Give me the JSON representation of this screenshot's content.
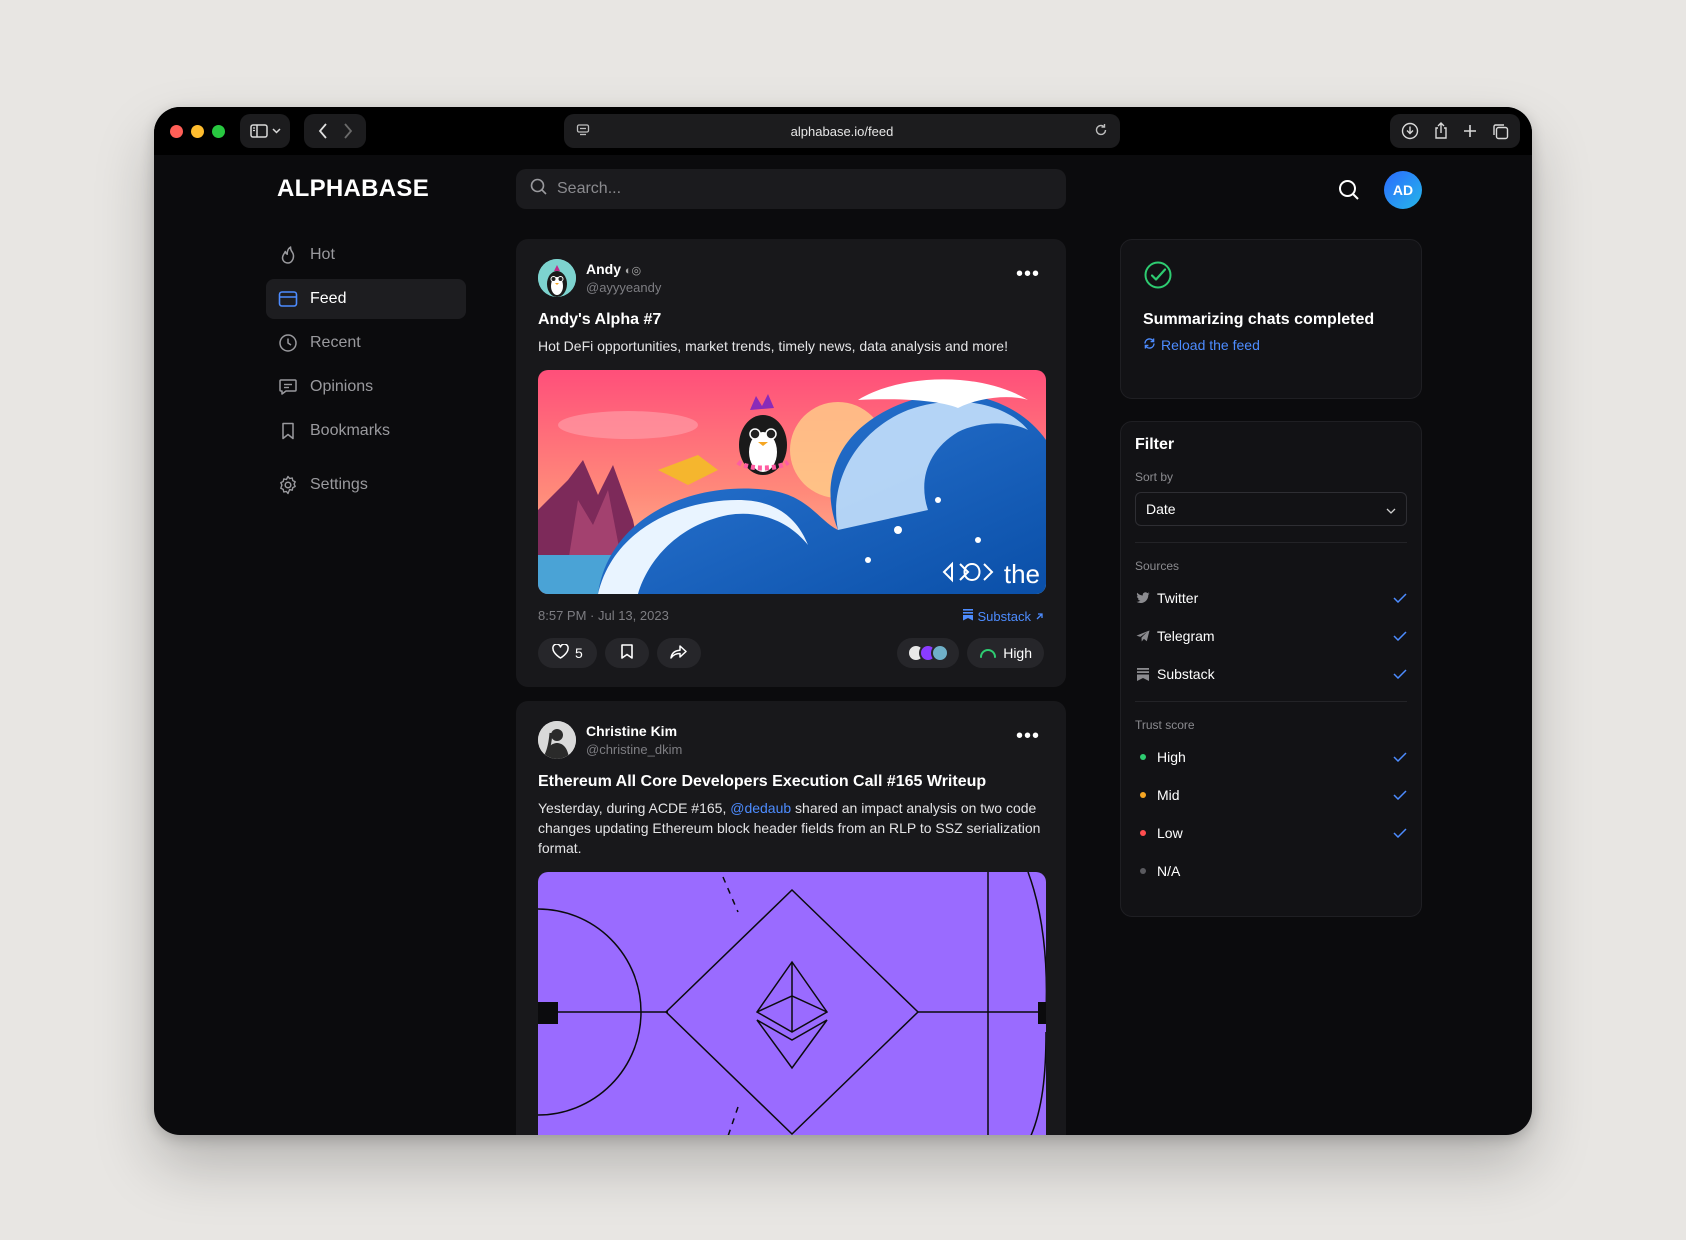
{
  "browser": {
    "url": "alphabase.io/feed"
  },
  "app": {
    "logo": "ALPHABASE",
    "search_placeholder": "Search...",
    "avatar_initials": "AD"
  },
  "nav": {
    "hot": "Hot",
    "feed": "Feed",
    "recent": "Recent",
    "opinions": "Opinions",
    "bookmarks": "Bookmarks",
    "settings": "Settings",
    "active": "Feed"
  },
  "posts": [
    {
      "author": "Andy",
      "handle": "@ayyyeandy",
      "title": "Andy's Alpha #7",
      "body": "Hot DeFi opportunities, market trends, timely news, data analysis and more!",
      "timestamp": "8:57 PM · Jul 13, 2023",
      "source": "Substack",
      "likes": "5",
      "trust": "High",
      "media_watermark": "the"
    },
    {
      "author": "Christine Kim",
      "handle": "@christine_dkim",
      "title": "Ethereum All Core Developers Execution Call #165 Writeup",
      "body_pre": "Yesterday, during ACDE #165, ",
      "mention": "@dedaub",
      "body_post": " shared an impact analysis on two code changes updating Ethereum block header fields from an RLP to SSZ serialization format."
    }
  ],
  "status": {
    "title": "Summarizing chats completed",
    "action": "Reload the feed"
  },
  "filter": {
    "title": "Filter",
    "sort_label": "Sort by",
    "sort_value": "Date",
    "sources_label": "Sources",
    "sources": [
      "Twitter",
      "Telegram",
      "Substack"
    ],
    "trust_label": "Trust score",
    "trust": [
      "High",
      "Mid",
      "Low",
      "N/A"
    ]
  },
  "colors": {
    "accent": "#4d8cff",
    "trust_high": "#2ecc71",
    "trust_mid": "#f5a623",
    "trust_low": "#ff4d4f",
    "trust_na": "#5a5a5f",
    "status_check": "#2ecc71",
    "eth_purple": "#9a6bff"
  }
}
